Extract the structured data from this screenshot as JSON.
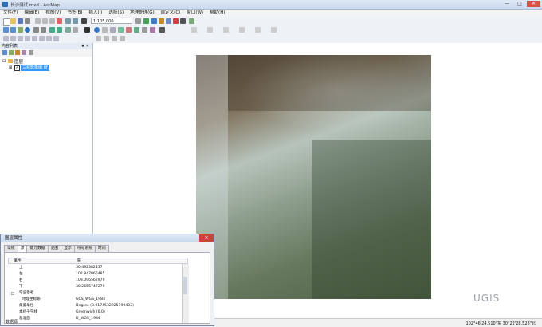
{
  "window": {
    "title": "长沙测试.mxd - ArcMap",
    "minimize": "—",
    "maximize": "□",
    "close": "✕"
  },
  "menu": [
    "文件(F)",
    "编辑(E)",
    "视图(V)",
    "书签(B)",
    "插入(I)",
    "选择(S)",
    "地理处理(G)",
    "自定义(C)",
    "窗口(W)",
    "帮助(H)"
  ],
  "toolbar": {
    "scale": "1:105,000"
  },
  "toc": {
    "header": "内容列表",
    "pin": "♦ ✕",
    "layers_group": "图层",
    "layer_name": "三峡影像图.tif"
  },
  "watermark": {
    "logo": "UGIS",
    "sub": "UGIS"
  },
  "status": {
    "coords": "102°46'24.510\"东  30°22'28.528\"北"
  },
  "dialog": {
    "title": "图层属性",
    "close": "✕",
    "tabs": [
      "常规",
      "源",
      "键元数据",
      "范围",
      "显示",
      "符号系统",
      "时间"
    ],
    "active_tab": 1,
    "columns": {
      "property": "属性",
      "value": "值"
    },
    "rows": [
      {
        "key": "上",
        "value": "30.492382137"
      },
      {
        "key": "左",
        "value": "102.847065485"
      },
      {
        "key": "右",
        "value": "103.096562979"
      },
      {
        "key": "下",
        "value": "30.2655747279"
      },
      {
        "key": "空间参考",
        "value": ""
      },
      {
        "key": "地理坐标系",
        "value": "GCS_WGS_1984"
      },
      {
        "key": "角度单位",
        "value": "Degree (0.0174532925199433)"
      },
      {
        "key": "本初子午线",
        "value": "Greenwich (0.0)"
      },
      {
        "key": "基准面",
        "value": "D_WGS_1984"
      }
    ],
    "footer": "数据源"
  }
}
